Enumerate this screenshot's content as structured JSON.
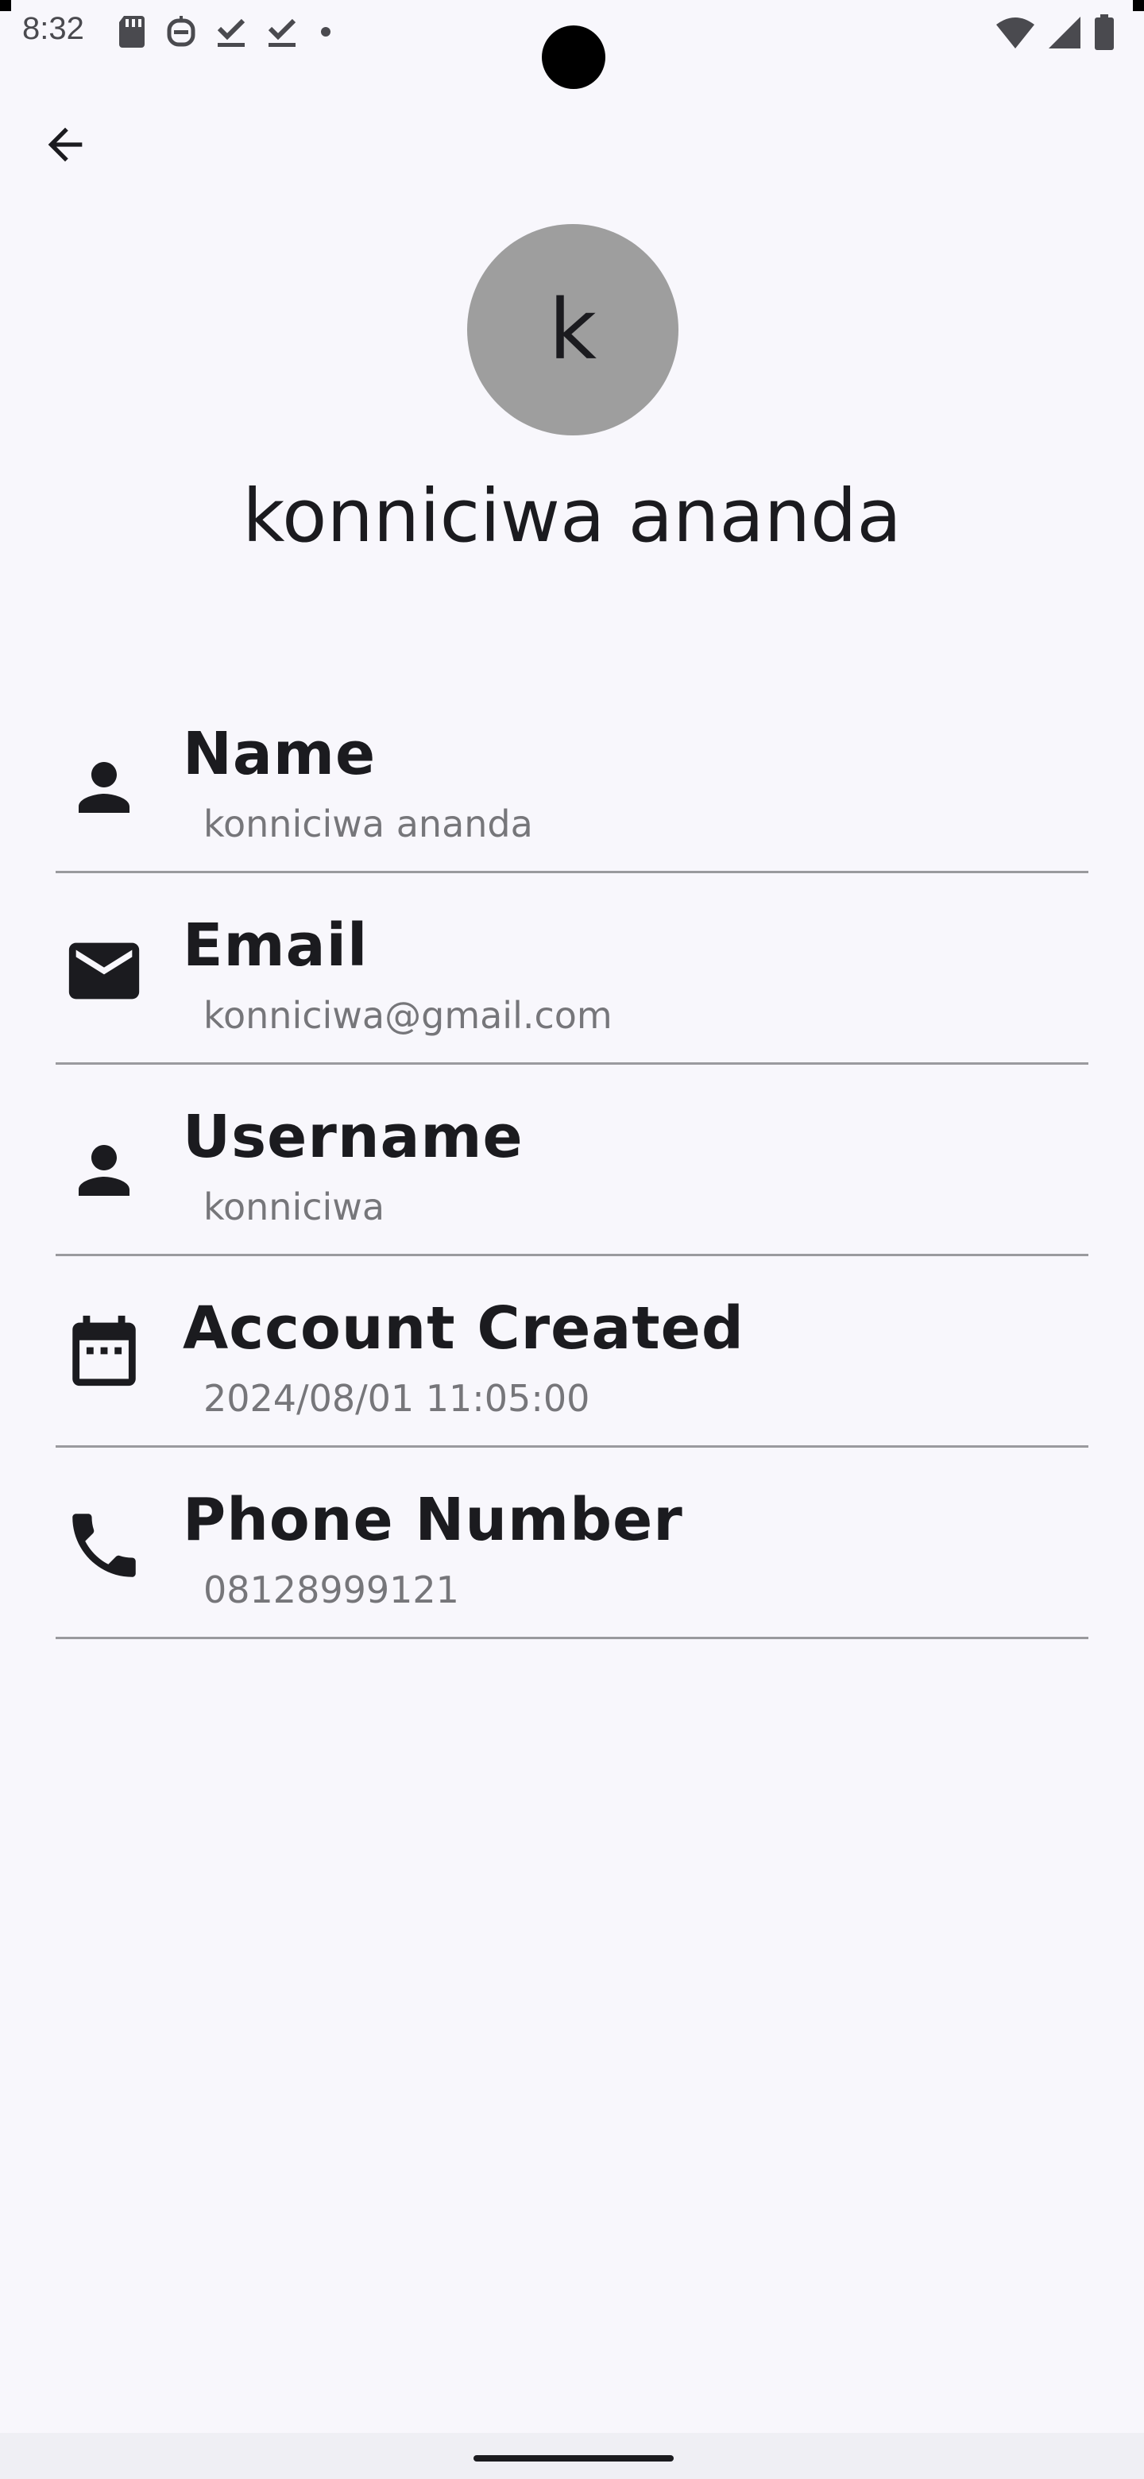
{
  "status_bar": {
    "time": "8:32",
    "left_icons": [
      "sd-card-icon",
      "robot-icon",
      "download-done-icon",
      "download-done-icon",
      "dot-icon"
    ],
    "right_icons": [
      "wifi-icon",
      "signal-icon",
      "battery-icon"
    ]
  },
  "header": {
    "back_icon": "arrow-back-icon"
  },
  "profile": {
    "avatar_initial": "k",
    "avatar_color": "#9e9e9e",
    "display_name": "konniciwa ananda"
  },
  "info_items": [
    {
      "icon": "person-icon",
      "label": "Name",
      "value": "konniciwa ananda"
    },
    {
      "icon": "mail-icon",
      "label": "Email",
      "value": "konniciwa@gmail.com"
    },
    {
      "icon": "person-icon",
      "label": "Username",
      "value": "konniciwa"
    },
    {
      "icon": "calendar-icon",
      "label": "Account Created",
      "value": "2024/08/01 11:05:00"
    },
    {
      "icon": "phone-icon",
      "label": "Phone Number",
      "value": "08128999121"
    }
  ],
  "colors": {
    "background": "#f8f7fc",
    "text_primary": "#1b1b1f",
    "text_secondary": "#76767a",
    "divider": "#9a9a9e"
  }
}
